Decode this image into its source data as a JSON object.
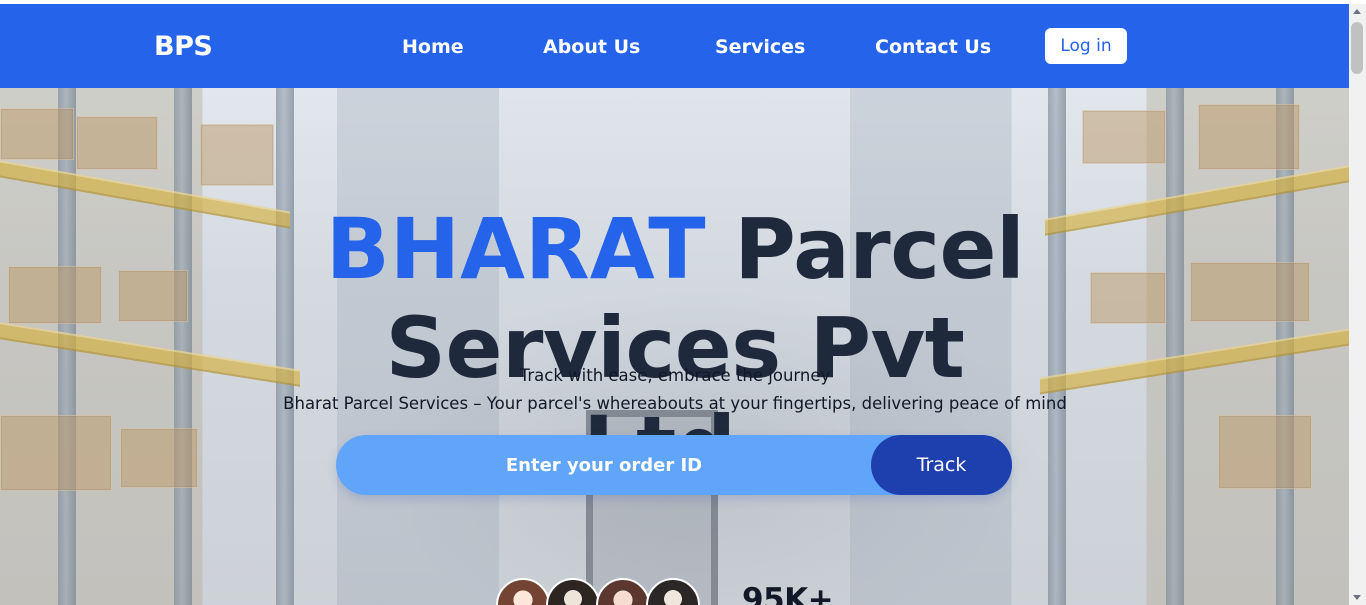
{
  "brand": {
    "name": "BPS"
  },
  "navigation": {
    "items": [
      {
        "label": "Home"
      },
      {
        "label": "About Us"
      },
      {
        "label": "Services"
      },
      {
        "label": "Contact Us"
      }
    ],
    "login_label": "Log in"
  },
  "hero": {
    "title_accent": "BHARAT",
    "title_rest": "Parcel Services Pvt Ltd.",
    "tagline_primary": "Track with ease, embrace the journey",
    "tagline_secondary": "Bharat Parcel Services – Your parcel's whereabouts at your fingertips, delivering peace of mind",
    "order_input_placeholder": "Enter your order ID",
    "track_label": "Track",
    "customer_count": "95K+"
  },
  "colors": {
    "brand_blue": "#2563eb",
    "title_dark": "#1e293b",
    "input_blue": "#60a5fa",
    "button_dark_blue": "#1e40af"
  },
  "icons": {
    "scroll_up": "scroll-up-arrow",
    "scroll_down": "scroll-down-arrow"
  }
}
